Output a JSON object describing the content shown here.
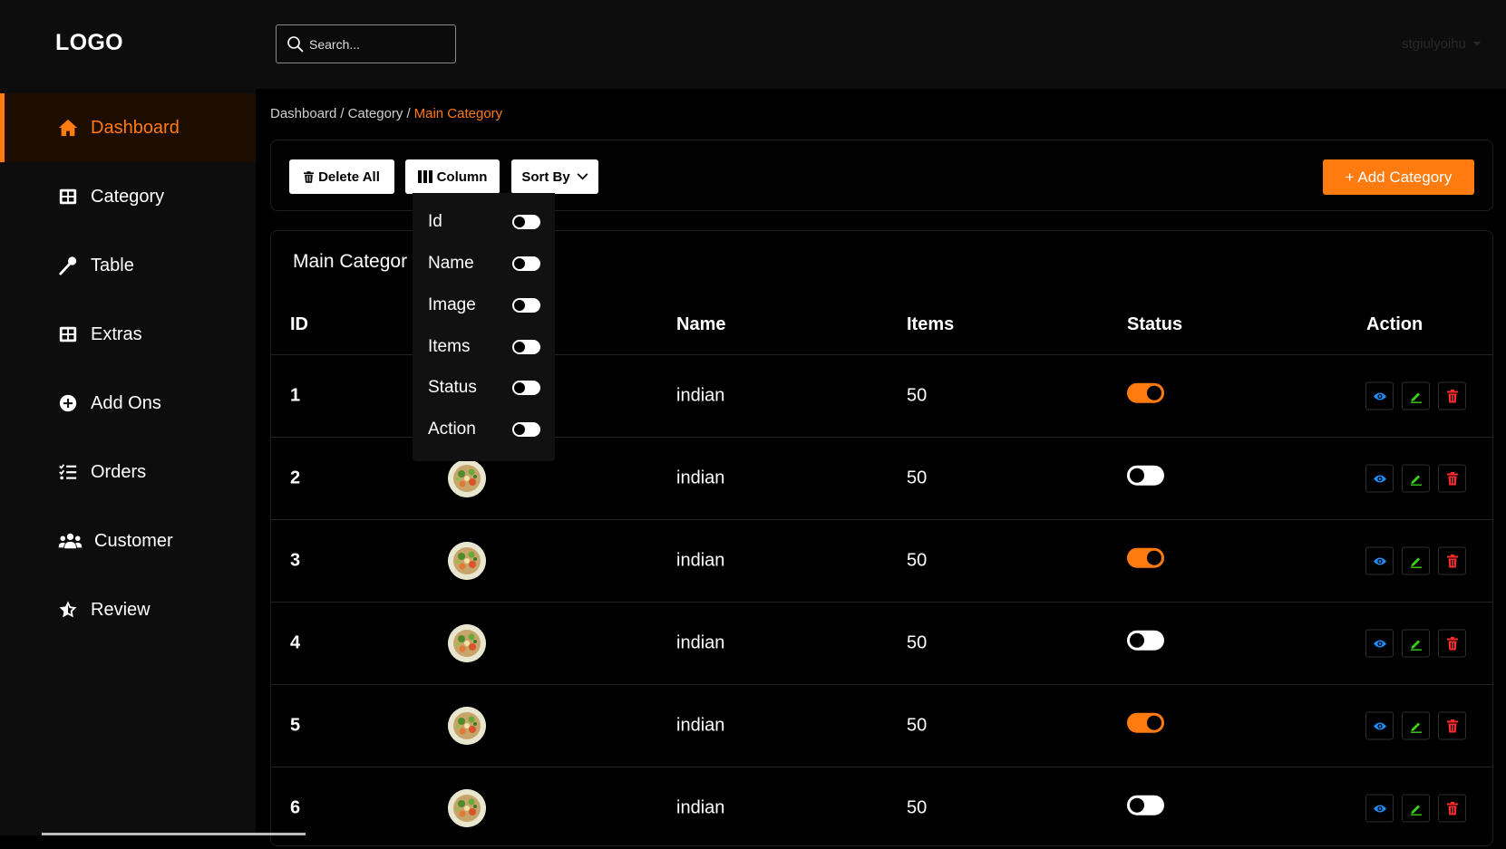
{
  "header": {
    "logo": "LOGO",
    "search_placeholder": "Search...",
    "user_name": "stgiulyoihu"
  },
  "sidebar": {
    "items": [
      {
        "label": "Dashboard",
        "icon": "home-icon",
        "active": true
      },
      {
        "label": "Category",
        "icon": "grid-icon",
        "active": false
      },
      {
        "label": "Table",
        "icon": "spoon-icon",
        "active": false
      },
      {
        "label": "Extras",
        "icon": "grid-icon",
        "active": false
      },
      {
        "label": "Add Ons",
        "icon": "plus-circle-icon",
        "active": false
      },
      {
        "label": "Orders",
        "icon": "list-icon",
        "active": false
      },
      {
        "label": "Customer",
        "icon": "users-icon",
        "active": false
      },
      {
        "label": "Review",
        "icon": "star-icon",
        "active": false
      }
    ]
  },
  "breadcrumb": {
    "items": [
      "Dashboard",
      "Category"
    ],
    "current": "Main Category",
    "separator": "/"
  },
  "toolbar": {
    "delete_all": "Delete All",
    "column": "Column",
    "sort_by": "Sort By",
    "add_category": "+ Add Category"
  },
  "column_menu": {
    "options": [
      "Id",
      "Name",
      "Image",
      "Items",
      "Status",
      "Action"
    ]
  },
  "table": {
    "title": "Main Categor",
    "headers": {
      "id": "ID",
      "name": "Name",
      "items": "Items",
      "status": "Status",
      "action": "Action"
    },
    "rows": [
      {
        "id": "1",
        "name": "indian",
        "items": "50",
        "status": true
      },
      {
        "id": "2",
        "name": "indian",
        "items": "50",
        "status": false
      },
      {
        "id": "3",
        "name": "indian",
        "items": "50",
        "status": true
      },
      {
        "id": "4",
        "name": "indian",
        "items": "50",
        "status": false
      },
      {
        "id": "5",
        "name": "indian",
        "items": "50",
        "status": true
      },
      {
        "id": "6",
        "name": "indian",
        "items": "50",
        "status": false
      }
    ]
  },
  "colors": {
    "accent": "#ff7a0f",
    "view_icon": "#1e8fff",
    "edit_icon": "#39d111",
    "delete_icon": "#ff2d2d"
  }
}
